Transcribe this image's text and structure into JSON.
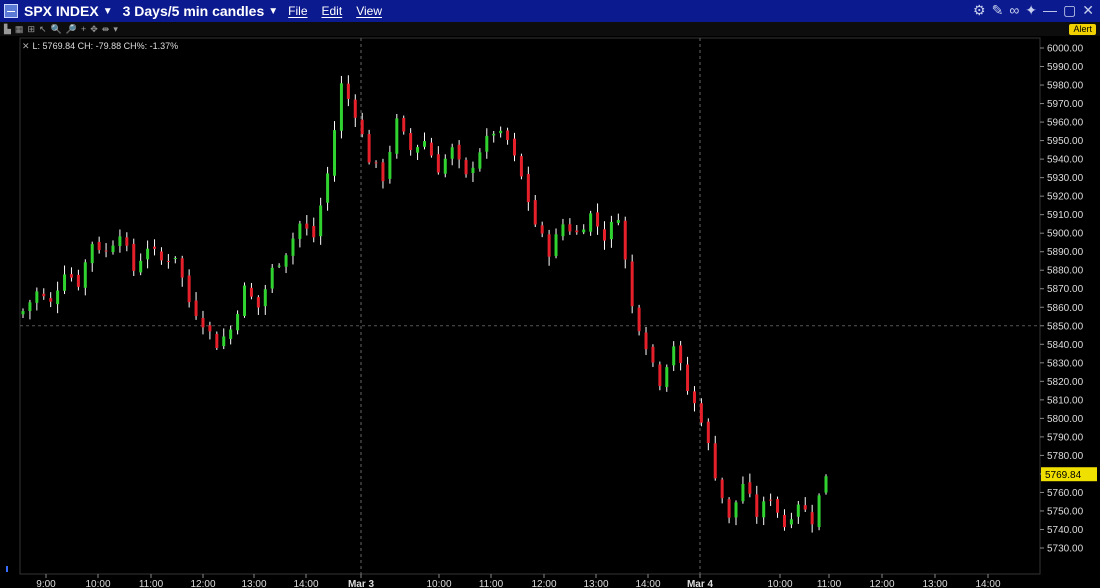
{
  "window": {
    "symbol": "SPX INDEX",
    "period": "3 Days/5 min candles",
    "menus": [
      "File",
      "Edit",
      "View"
    ],
    "alert_label": "Alert"
  },
  "readout": {
    "text": "L: 5769.84 CH: -79.88 CH%: -1.37%"
  },
  "colors": {
    "up": "#2fd22f",
    "down": "#e6202a",
    "wick": "#ffffff",
    "grid": "#2a2a2a",
    "price_tag_bg": "#f0e000",
    "titlebar": "#0b1a8f"
  },
  "icons": [
    "app-chart-icon",
    "chart-settings-icon",
    "wrench-icon",
    "link-icon",
    "pin-icon",
    "minimize-icon",
    "maximize-icon",
    "close-icon"
  ],
  "chart_data": {
    "type": "candlestick",
    "title": "SPX INDEX",
    "ylim": [
      5722,
      6003
    ],
    "y_ticks": [
      "6000.00",
      "5990.00",
      "5980.00",
      "5970.00",
      "5960.00",
      "5950.00",
      "5940.00",
      "5930.00",
      "5920.00",
      "5910.00",
      "5900.00",
      "5890.00",
      "5880.00",
      "5870.00",
      "5860.00",
      "5850.00",
      "5840.00",
      "5830.00",
      "5820.00",
      "5810.00",
      "5800.00",
      "5790.00",
      "5780.00",
      "5770.00",
      "5760.00",
      "5750.00",
      "5740.00",
      "5730.00"
    ],
    "x_ticks": [
      "9:00",
      "10:00",
      "11:00",
      "12:00",
      "13:00",
      "14:00",
      "Mar 3",
      "10:00",
      "11:00",
      "12:00",
      "13:00",
      "14:00",
      "Mar 4",
      "10:00",
      "11:00",
      "12:00",
      "13:00",
      "14:00"
    ],
    "last_price": "5769.84",
    "reference_price": 5850,
    "grid": true,
    "candle_close_path": [
      [
        0,
        5858
      ],
      [
        2,
        5868
      ],
      [
        4,
        5862
      ],
      [
        6,
        5880
      ],
      [
        8,
        5873
      ],
      [
        10,
        5895
      ],
      [
        12,
        5890
      ],
      [
        14,
        5901
      ],
      [
        16,
        5880
      ],
      [
        18,
        5893
      ],
      [
        20,
        5885
      ],
      [
        22,
        5888
      ],
      [
        24,
        5863
      ],
      [
        26,
        5852
      ],
      [
        28,
        5840
      ],
      [
        30,
        5848
      ],
      [
        32,
        5870
      ],
      [
        34,
        5860
      ],
      [
        36,
        5880
      ],
      [
        38,
        5890
      ],
      [
        40,
        5905
      ],
      [
        42,
        5898
      ],
      [
        44,
        5932
      ],
      [
        46,
        5980
      ],
      [
        48,
        5965
      ],
      [
        50,
        5940
      ],
      [
        52,
        5930
      ],
      [
        54,
        5960
      ],
      [
        56,
        5945
      ],
      [
        58,
        5950
      ],
      [
        60,
        5935
      ],
      [
        62,
        5945
      ],
      [
        64,
        5930
      ],
      [
        66,
        5945
      ],
      [
        68,
        5955
      ],
      [
        70,
        5950
      ],
      [
        72,
        5930
      ],
      [
        74,
        5905
      ],
      [
        76,
        5890
      ],
      [
        78,
        5905
      ],
      [
        80,
        5900
      ],
      [
        82,
        5910
      ],
      [
        84,
        5898
      ],
      [
        86,
        5910
      ],
      [
        88,
        5860
      ],
      [
        90,
        5840
      ],
      [
        92,
        5820
      ],
      [
        94,
        5840
      ],
      [
        96,
        5815
      ],
      [
        98,
        5800
      ],
      [
        100,
        5770
      ],
      [
        102,
        5745
      ],
      [
        104,
        5765
      ],
      [
        106,
        5748
      ],
      [
        108,
        5758
      ],
      [
        110,
        5742
      ],
      [
        112,
        5755
      ],
      [
        114,
        5745
      ],
      [
        116,
        5770
      ]
    ]
  }
}
